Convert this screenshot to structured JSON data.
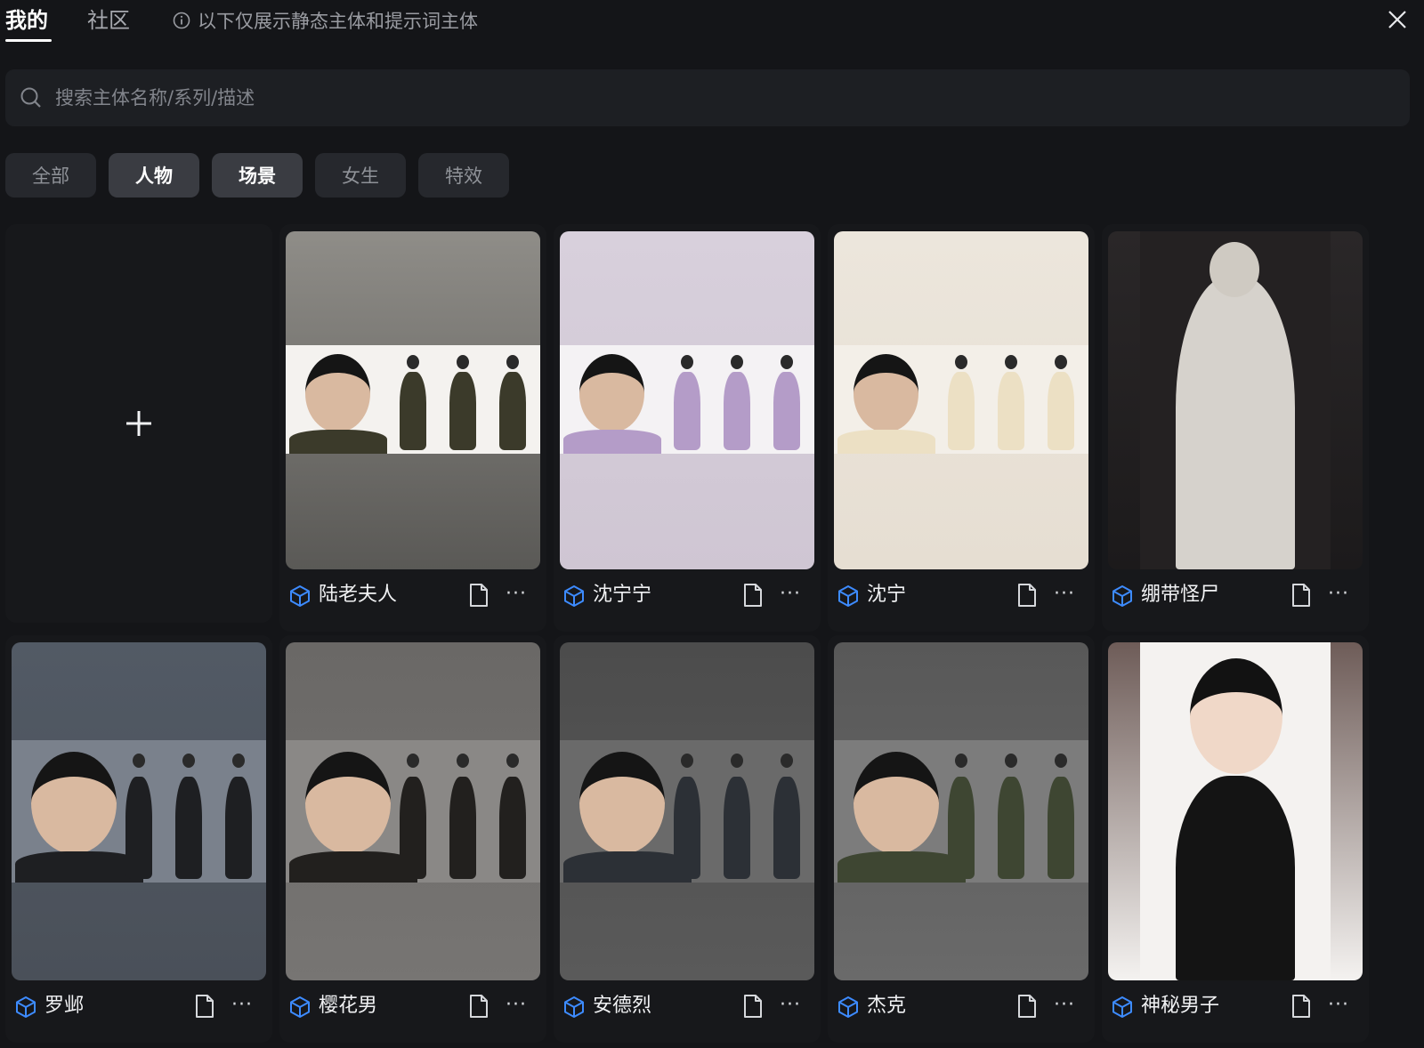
{
  "tabs": {
    "mine": "我的",
    "community": "社区"
  },
  "notice": "以下仅展示静态主体和提示词主体",
  "search": {
    "placeholder": "搜索主体名称/系列/描述"
  },
  "filters": [
    {
      "label": "全部",
      "selected": false
    },
    {
      "label": "人物",
      "selected": true
    },
    {
      "label": "场景",
      "selected": true
    },
    {
      "label": "女生",
      "selected": false
    },
    {
      "label": "特效",
      "selected": false
    }
  ],
  "add_icon": "plus-icon",
  "cards": [
    {
      "name": "陆老夫人",
      "bg": [
        "#8f8d88",
        "#5a5956"
      ],
      "band": "#f4f2ef",
      "outfit": "#3b3a2a"
    },
    {
      "name": "沈宁宁",
      "bg": [
        "#d8d0dc",
        "#cfc6d3"
      ],
      "band": "#f4f2f4",
      "outfit": "#b49cc8"
    },
    {
      "name": "沈宁",
      "bg": [
        "#ece6dc",
        "#e6ded2"
      ],
      "band": "#f3efe8",
      "outfit": "#ece0c4"
    },
    {
      "name": "绷带怪尸",
      "bg": [
        "#2a2728",
        "#1c1a1b"
      ],
      "band": "#242122",
      "outfit": "#d6d2cc"
    },
    {
      "name": "罗邺",
      "bg": [
        "#525a65",
        "#4a5059"
      ],
      "band": "#7a818c",
      "outfit": "#1e1f22"
    },
    {
      "name": "樱花男",
      "bg": [
        "#6a6866",
        "#777573"
      ],
      "band": "#8a8886",
      "outfit": "#22201e"
    },
    {
      "name": "安德烈",
      "bg": [
        "#4c4c4c",
        "#5a5a5a"
      ],
      "band": "#6a6a6a",
      "outfit": "#2c3036"
    },
    {
      "name": "杰克",
      "bg": [
        "#585858",
        "#6a6a6a"
      ],
      "band": "#7c7c7c",
      "outfit": "#3e4632"
    },
    {
      "name": "神秘男子",
      "bg": [
        "#6e5c58",
        "#f4f2f0"
      ],
      "band": "#f4f2f0",
      "outfit": "#141414"
    }
  ]
}
